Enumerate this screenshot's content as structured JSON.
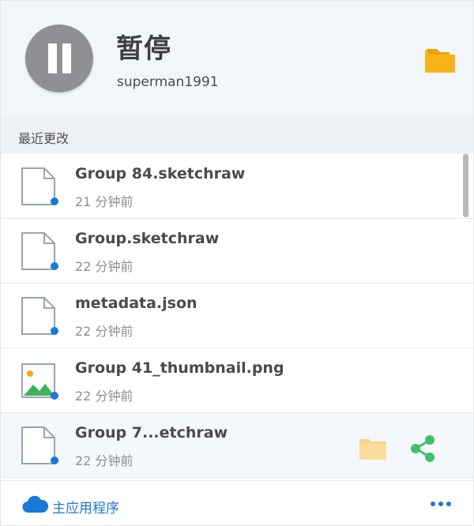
{
  "header": {
    "status_title": "暂停",
    "username": "superman1991",
    "pause_icon": "pause-icon",
    "folder_icon": "folder-icon"
  },
  "section": {
    "label": "最近更改"
  },
  "files": [
    {
      "name": "Group 84.sketchraw",
      "time": "21 分钟前",
      "icon": "document-icon"
    },
    {
      "name": "Group.sketchraw",
      "time": "22 分钟前",
      "icon": "document-icon"
    },
    {
      "name": "metadata.json",
      "time": "22 分钟前",
      "icon": "document-icon"
    },
    {
      "name": "Group 41_thumbnail.png",
      "time": "22 分钟前",
      "icon": "image-icon"
    },
    {
      "name": "Group 7...etchraw",
      "time": "22 分钟前",
      "icon": "document-icon"
    }
  ],
  "footer": {
    "main_app_label": "主应用程序",
    "more_icon": "more-icon"
  },
  "colors": {
    "accent": "#1a78d6",
    "folder": "#f6b419",
    "share": "#3cc26a",
    "sync_dot": "#1a78d6"
  }
}
